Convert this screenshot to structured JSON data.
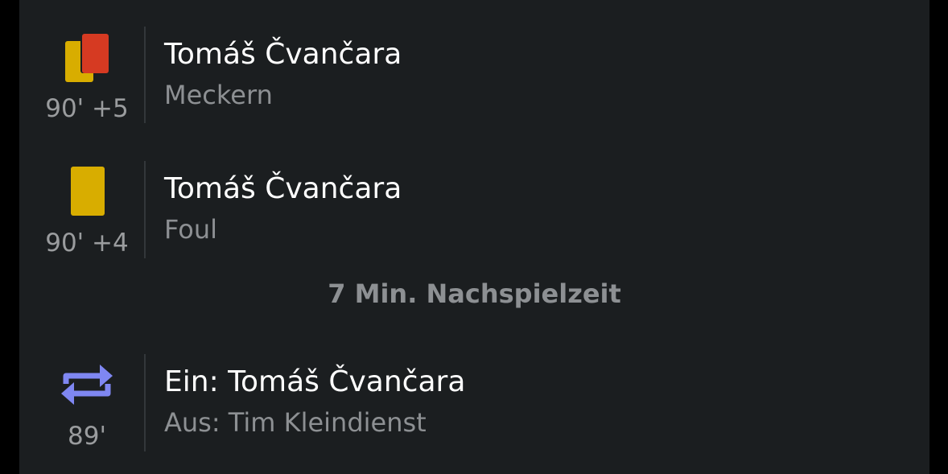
{
  "colors": {
    "background": "#1b1e20",
    "primary_text": "#ffffff",
    "secondary_text": "#8d9093",
    "yellow_card": "#d8ad00",
    "red_card": "#d63a22",
    "substitution": "#7f87f2"
  },
  "events": [
    {
      "icon": "yellow-red-card-icon",
      "minute": "90' +5",
      "player": "Tomáš Čvančara",
      "detail": "Meckern"
    },
    {
      "icon": "yellow-card-icon",
      "minute": "90' +4",
      "player": "Tomáš Čvančara",
      "detail": "Foul"
    },
    {
      "icon": "substitution-icon",
      "minute": "89'",
      "player": "Ein: Tomáš Čvančara",
      "detail": "Aus: Tim Kleindienst"
    }
  ],
  "stoppage_notice": "7 Min. Nachspielzeit"
}
